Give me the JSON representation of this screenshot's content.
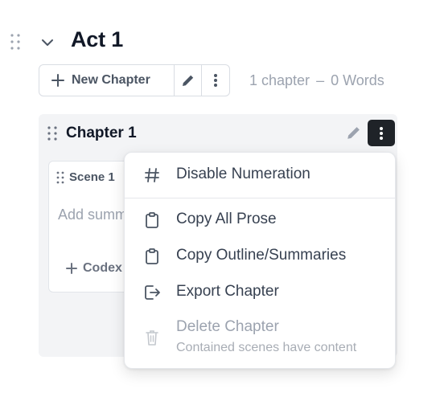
{
  "act": {
    "title": "Act 1"
  },
  "toolbar": {
    "new_chapter_label": "New Chapter"
  },
  "counts": {
    "chapters": "1 chapter",
    "separator": "–",
    "words": "0 Words"
  },
  "chapter": {
    "title": "Chapter 1"
  },
  "scene": {
    "title": "Scene 1",
    "summary_placeholder": "Add summary",
    "codex_label": "Codex"
  },
  "menu": {
    "items": [
      {
        "label": "Disable Numeration",
        "icon": "hash-icon",
        "enabled": true
      },
      {
        "label": "Copy All Prose",
        "icon": "clipboard-icon",
        "enabled": true
      },
      {
        "label": "Copy Outline/Summaries",
        "icon": "clipboard-icon",
        "enabled": true
      },
      {
        "label": "Export Chapter",
        "icon": "export-icon",
        "enabled": true
      },
      {
        "label": "Delete Chapter",
        "sublabel": "Contained scenes have content",
        "icon": "trash-icon",
        "enabled": false
      }
    ]
  },
  "colors": {
    "accent_dark": "#1f2328",
    "muted_text": "#9ca3af",
    "card_bg": "#f3f4f6"
  }
}
